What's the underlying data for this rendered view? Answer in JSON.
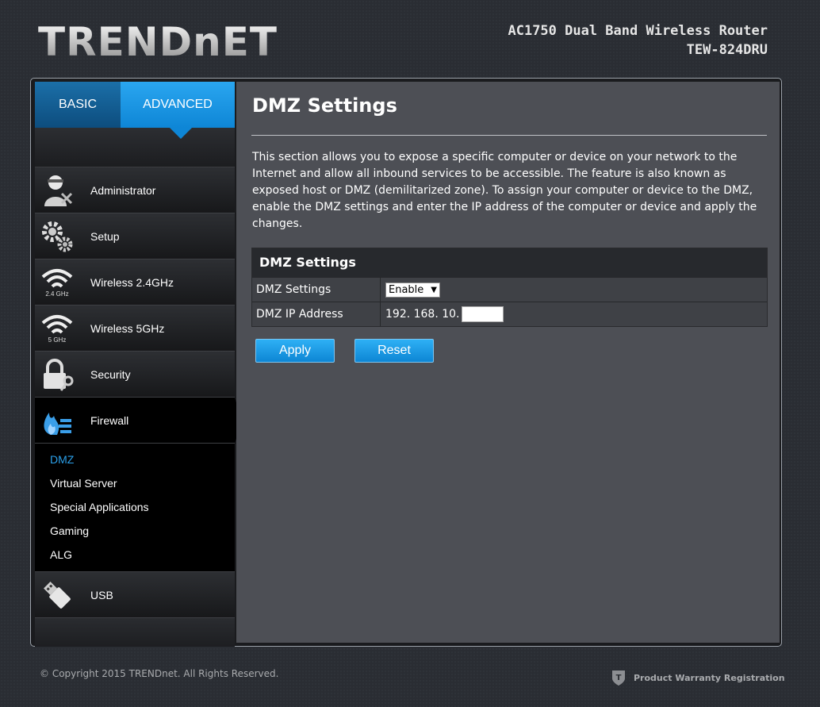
{
  "header": {
    "logo": "TRENDnET",
    "product_line": "AC1750 Dual Band Wireless Router",
    "model": "TEW-824DRU"
  },
  "tabs": [
    {
      "label": "BASIC"
    },
    {
      "label": "ADVANCED"
    }
  ],
  "sidebar": {
    "items": [
      {
        "label": "Administrator",
        "icon": "administrator-icon"
      },
      {
        "label": "Setup",
        "icon": "gears-icon"
      },
      {
        "label": "Wireless 2.4GHz",
        "icon": "wifi-icon",
        "badge": "2.4 GHz"
      },
      {
        "label": "Wireless 5GHz",
        "icon": "wifi-icon",
        "badge": "5 GHz"
      },
      {
        "label": "Security",
        "icon": "lock-icon"
      },
      {
        "label": "Firewall",
        "icon": "firewall-icon"
      },
      {
        "label": "USB",
        "icon": "usb-icon"
      }
    ],
    "firewall_sub": [
      {
        "label": "DMZ"
      },
      {
        "label": "Virtual Server"
      },
      {
        "label": "Special Applications"
      },
      {
        "label": "Gaming"
      },
      {
        "label": "ALG"
      }
    ]
  },
  "main": {
    "title": "DMZ Settings",
    "description": "This section allows you to expose a specific computer or device on your network to the Internet and allow all inbound services to be accessible. The feature is also known as exposed host or DMZ (demilitarized zone). To assign your computer or device to the DMZ, enable the DMZ settings and enter the IP address of the computer or device and apply the changes.",
    "table": {
      "heading": "DMZ Settings",
      "rows": [
        {
          "label": "DMZ Settings",
          "value": "Enable"
        },
        {
          "label": "DMZ IP Address",
          "prefix": "192. 168. 10.",
          "input_value": ""
        }
      ]
    },
    "buttons": {
      "apply": "Apply",
      "reset": "Reset"
    }
  },
  "footer": {
    "copyright": "© Copyright 2015 TRENDnet. All Rights Reserved.",
    "warranty": "Product Warranty Registration"
  },
  "colors": {
    "accent": "#0e86d6",
    "active_text": "#2ba0ea",
    "content_bg": "#4d4f55"
  }
}
